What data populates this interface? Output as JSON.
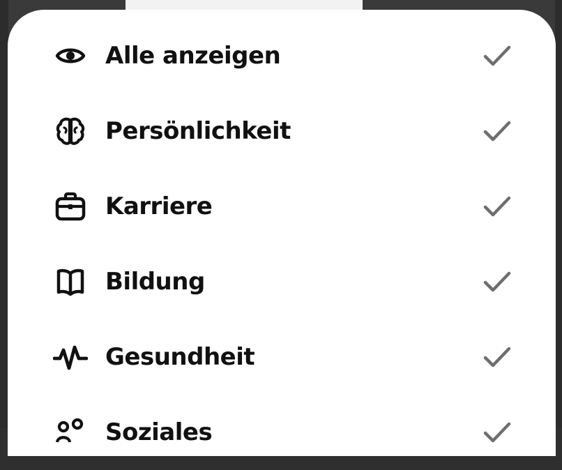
{
  "sheet": {
    "items": [
      {
        "label": "Alle anzeigen",
        "icon": "eye-icon",
        "checked": true
      },
      {
        "label": "Persönlichkeit",
        "icon": "brain-icon",
        "checked": true
      },
      {
        "label": "Karriere",
        "icon": "briefcase-icon",
        "checked": true
      },
      {
        "label": "Bildung",
        "icon": "book-icon",
        "checked": true
      },
      {
        "label": "Gesundheit",
        "icon": "pulse-icon",
        "checked": true
      },
      {
        "label": "Soziales",
        "icon": "people-icon",
        "checked": true
      }
    ],
    "check_color": "#6e6e6e",
    "icon_color": "#111111"
  }
}
